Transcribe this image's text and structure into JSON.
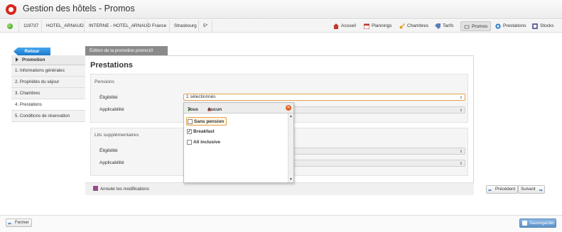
{
  "app": {
    "title": "Gestion des hôtels - Promos"
  },
  "infobar": {
    "id": "119737",
    "hotel": "HOTEL_ARNAUD",
    "channel": "INTERNE - HOTEL_ARNAUD",
    "country": "France",
    "city": "Strasbourg",
    "stars": "5*"
  },
  "nav": {
    "items": [
      {
        "label": "Accueil",
        "icon": "home-icon"
      },
      {
        "label": "Plannings",
        "icon": "calendar-icon"
      },
      {
        "label": "Chambres",
        "icon": "key-icon"
      },
      {
        "label": "Tarifs",
        "icon": "tag-icon"
      },
      {
        "label": "Promos",
        "icon": "promo-icon",
        "active": true
      },
      {
        "label": "Prestations",
        "icon": "plus-circle-icon"
      },
      {
        "label": "Stocks",
        "icon": "stocks-icon"
      }
    ]
  },
  "tabs": {
    "back_label": "Retour",
    "edit_label": "Édition de la promotion promo10"
  },
  "sidebar": {
    "header": "Promotion",
    "items": [
      {
        "label": "1. Informations générales"
      },
      {
        "label": "2. Propriétés du séjour"
      },
      {
        "label": "3. Chambres"
      },
      {
        "label": "4. Prestations",
        "active": true
      },
      {
        "label": "5. Conditions de réservation"
      }
    ]
  },
  "main": {
    "title": "Prestations",
    "pensions": {
      "title": "Pensions",
      "eligibility_label": "Éligibilité",
      "eligibility_value": "1 sélectionnés",
      "applicability_label": "Applicabilité",
      "applicability_value": ""
    },
    "extra_beds": {
      "title": "Lits supplémentaires",
      "eligibility_label": "Éligibilité",
      "applicability_label": "Applicabilité"
    }
  },
  "dropdown": {
    "all_label": "Tous",
    "none_label": "Aucun",
    "options": [
      {
        "label": "Sans pension",
        "checked": false,
        "highlighted": true
      },
      {
        "label": "Breakfast",
        "checked": true
      },
      {
        "label": "All inclusive",
        "checked": false
      }
    ]
  },
  "footer": {
    "cancel_label": "Annuler les modifications",
    "prev_label": "Précédent",
    "next_label": "Suivant"
  },
  "bottom": {
    "close_label": "Fermer",
    "save_label": "Sauvegarder"
  }
}
